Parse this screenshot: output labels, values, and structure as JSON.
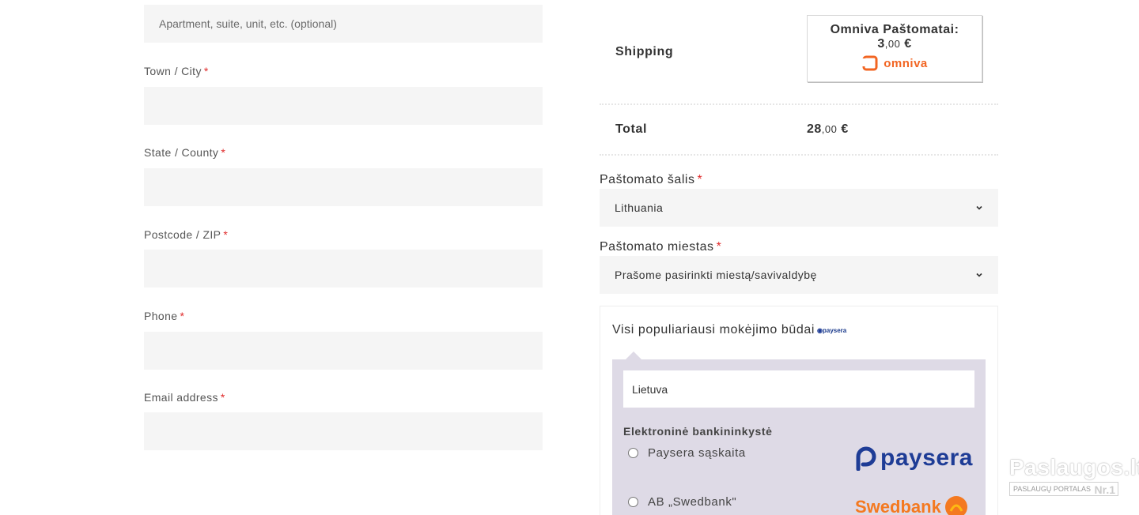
{
  "billing": {
    "address2_placeholder": "Apartment, suite, unit, etc. (optional)",
    "city_label": "Town / City",
    "state_label": "State / County",
    "postcode_label": "Postcode / ZIP",
    "phone_label": "Phone",
    "email_label": "Email address",
    "required_mark": "*"
  },
  "order": {
    "shipping_label": "Shipping",
    "shipping_method": "Omniva Paštomatai:",
    "shipping_price_int": "3",
    "shipping_price_dec": ",00",
    "currency": "€",
    "carrier_logo_text": "omniva",
    "total_label": "Total",
    "total_int": "28",
    "total_dec": ",00"
  },
  "parcel": {
    "country_label": "Paštomato šalis",
    "country_value": "Lithuania",
    "city_label": "Paštomato miestas",
    "city_value": "Prašome pasirinkti miestą/savivaldybę"
  },
  "payment": {
    "title": "Visi populiariausi mokėjimo būdai",
    "mini_logo": "paysera",
    "country_value": "Lietuva",
    "group_title": "Elektroninė bankininkystė",
    "options": [
      {
        "label": "Paysera sąskaita",
        "logo": "paysera"
      },
      {
        "label": "AB „Swedbank\"",
        "logo": "Swedbank"
      }
    ]
  },
  "watermark": {
    "main": "Paslaugos.lt",
    "sub": "PASLAUGŲ PORTALAS",
    "badge": "Nr.1"
  },
  "colors": {
    "required": "#e02b2b",
    "omniva": "#f26522",
    "paysera": "#1e3c96",
    "swedbank": "#f47920",
    "panel": "#dedae6"
  }
}
